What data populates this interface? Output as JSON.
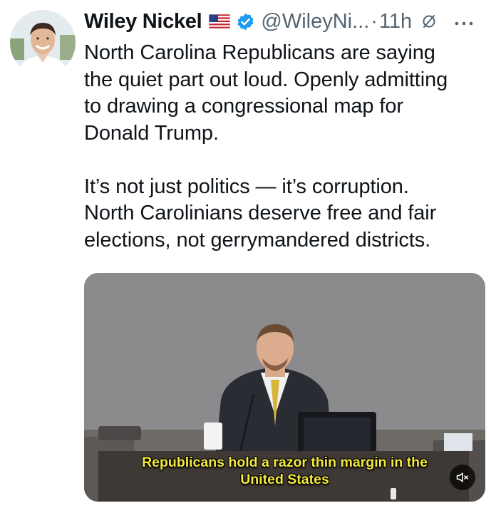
{
  "tweet": {
    "author_name": "Wiley Nickel",
    "handle": "@WileyNi...",
    "separator": "·",
    "time": "11h",
    "text": "North Carolina Republicans are saying\nthe quiet part out loud. Openly admitting\nto drawing a congressional map for\nDonald Trump.\n\nIt’s not just politics — it’s corruption.\nNorth Carolinians deserve free and fair\nelections, not gerrymandered districts.",
    "icons": {
      "flag": "us-flag-icon",
      "verified": "verified-badge-icon",
      "retweet": "repost-icon",
      "more": "more-options-icon"
    }
  },
  "media": {
    "caption": "Republicans hold a razor thin margin in the\nUnited States",
    "mute_icon": "muted-speaker-icon"
  },
  "colors": {
    "text": "#0f1419",
    "secondary": "#536471",
    "verified_blue": "#1d9bf0",
    "caption_yellow": "#f6e93e"
  }
}
